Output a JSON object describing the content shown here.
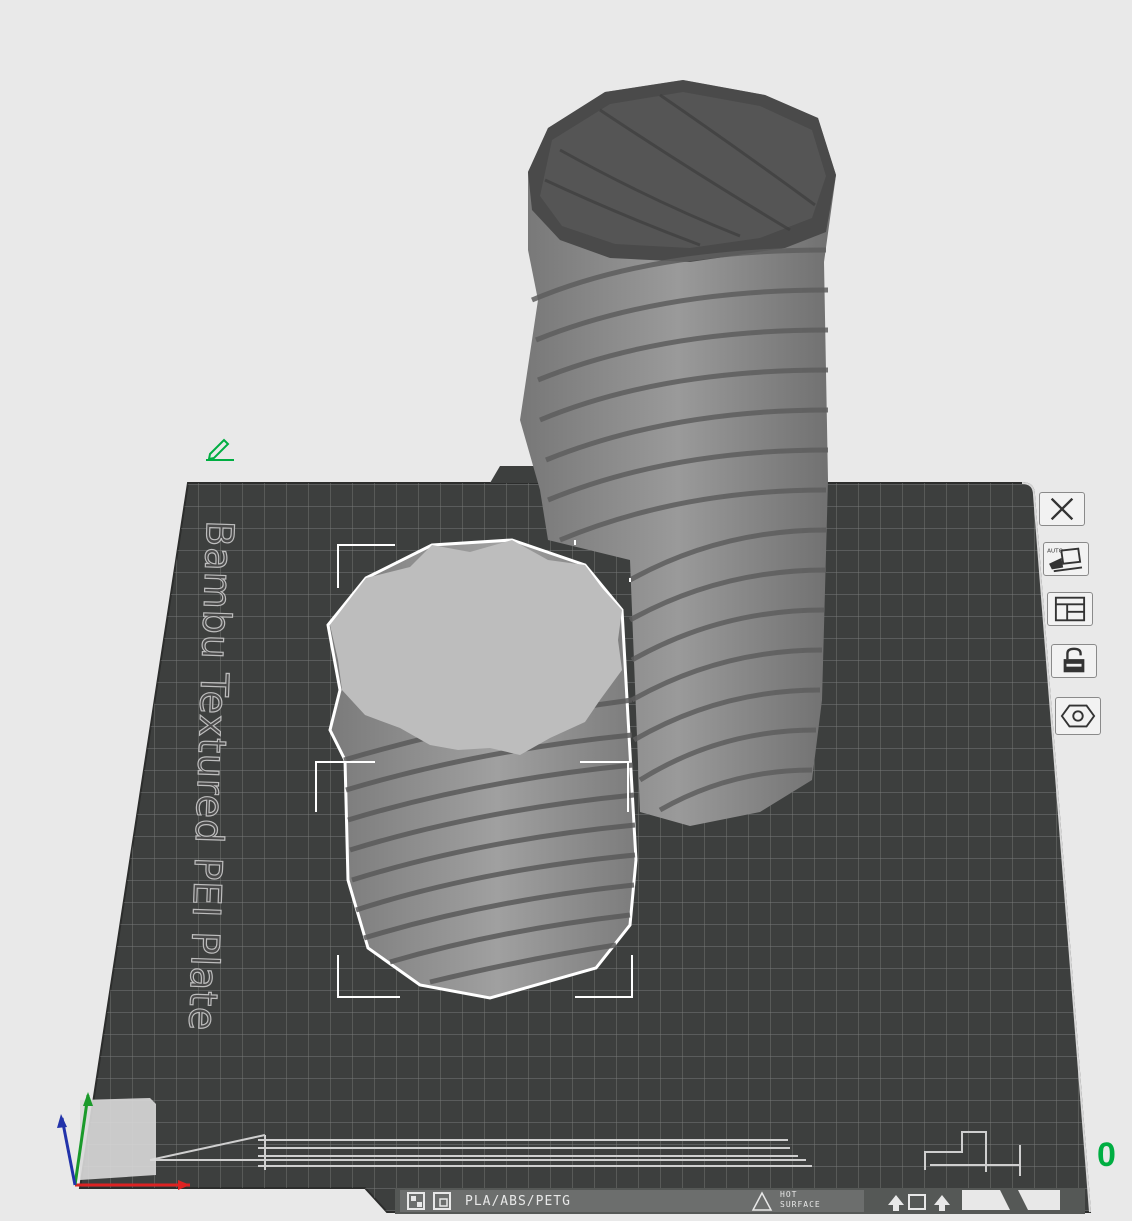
{
  "plate": {
    "name": "Bambu Textured PEI Plate",
    "filament_compat": "PLA/ABS/PETG",
    "hot_surface_line1": "HOT",
    "hot_surface_line2": "SURFACE"
  },
  "viewport": {
    "zoom_readout": "0"
  },
  "side_toolbar": {
    "buttons": [
      {
        "name": "remove-plate-button",
        "icon": "close-icon"
      },
      {
        "name": "auto-orient-button",
        "icon": "auto-orient-icon",
        "badge": "AUTO"
      },
      {
        "name": "arrange-button",
        "icon": "arrange-icon"
      },
      {
        "name": "lock-plate-button",
        "icon": "unlock-icon"
      },
      {
        "name": "plate-settings-button",
        "icon": "hexagon-icon"
      }
    ]
  },
  "colors": {
    "background": "#e9e9e9",
    "plate": "#3d3f3e",
    "grid": "#8c8e8d",
    "model_top": "#bdbdbd",
    "model_side": "#8e8e8e",
    "model_dark": "#4a4a4a",
    "accent": "#00ae42",
    "selection": "#ffffff"
  }
}
